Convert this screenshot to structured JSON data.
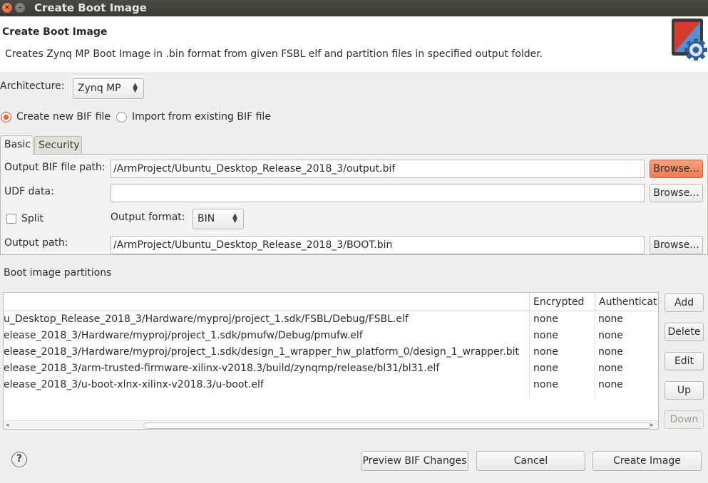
{
  "window": {
    "title": "Create Boot Image"
  },
  "header": {
    "title": "Create Boot Image",
    "description": "Creates Zynq MP Boot Image in .bin format from given FSBL elf and partition files in specified output folder.",
    "icon": "boot-image-gear-icon"
  },
  "architecture": {
    "label": "Architecture:",
    "value": "Zynq MP"
  },
  "bif_mode": {
    "create_label": "Create new BIF file",
    "import_label": "Import from existing BIF file",
    "selected": "create"
  },
  "tabs": [
    {
      "label": "Basic",
      "active": true
    },
    {
      "label": "Security",
      "active": false
    }
  ],
  "basic": {
    "output_bif_label": "Output BIF file path:",
    "output_bif_value": "/ArmProject/Ubuntu_Desktop_Release_2018_3/output.bif",
    "udf_label": "UDF data:",
    "udf_value": "",
    "split_label": "Split",
    "split_checked": false,
    "output_format_label": "Output format:",
    "output_format_value": "BIN",
    "output_path_label": "Output path:",
    "output_path_value": "/ArmProject/Ubuntu_Desktop_Release_2018_3/BOOT.bin",
    "browse_label": "Browse..."
  },
  "partitions": {
    "section_label": "Boot image partitions",
    "columns": [
      "",
      "Encrypted",
      "Authenticat"
    ],
    "rows": [
      {
        "path": "u_Desktop_Release_2018_3/Hardware/myproj/project_1.sdk/FSBL/Debug/FSBL.elf",
        "encrypted": "none",
        "authenticated": "none"
      },
      {
        "path": "elease_2018_3/Hardware/myproj/project_1.sdk/pmufw/Debug/pmufw.elf",
        "encrypted": "none",
        "authenticated": "none"
      },
      {
        "path": "elease_2018_3/Hardware/myproj/project_1.sdk/design_1_wrapper_hw_platform_0/design_1_wrapper.bit",
        "encrypted": "none",
        "authenticated": "none"
      },
      {
        "path": "elease_2018_3/arm-trusted-firmware-xilinx-v2018.3/build/zynqmp/release/bl31/bl31.elf",
        "encrypted": "none",
        "authenticated": "none"
      },
      {
        "path": "elease_2018_3/u-boot-xlnx-xilinx-v2018.3/u-boot.elf",
        "encrypted": "none",
        "authenticated": "none"
      }
    ],
    "buttons": {
      "add": "Add",
      "delete": "Delete",
      "edit": "Edit",
      "up": "Up",
      "down": "Down"
    }
  },
  "footer": {
    "help_symbol": "?",
    "preview_label": "Preview BIF Changes",
    "cancel_label": "Cancel",
    "create_label": "Create Image"
  },
  "colors": {
    "accent": "#ee7d52",
    "radio_selected": "#e9683a",
    "titlebar": "#3b3a37"
  }
}
